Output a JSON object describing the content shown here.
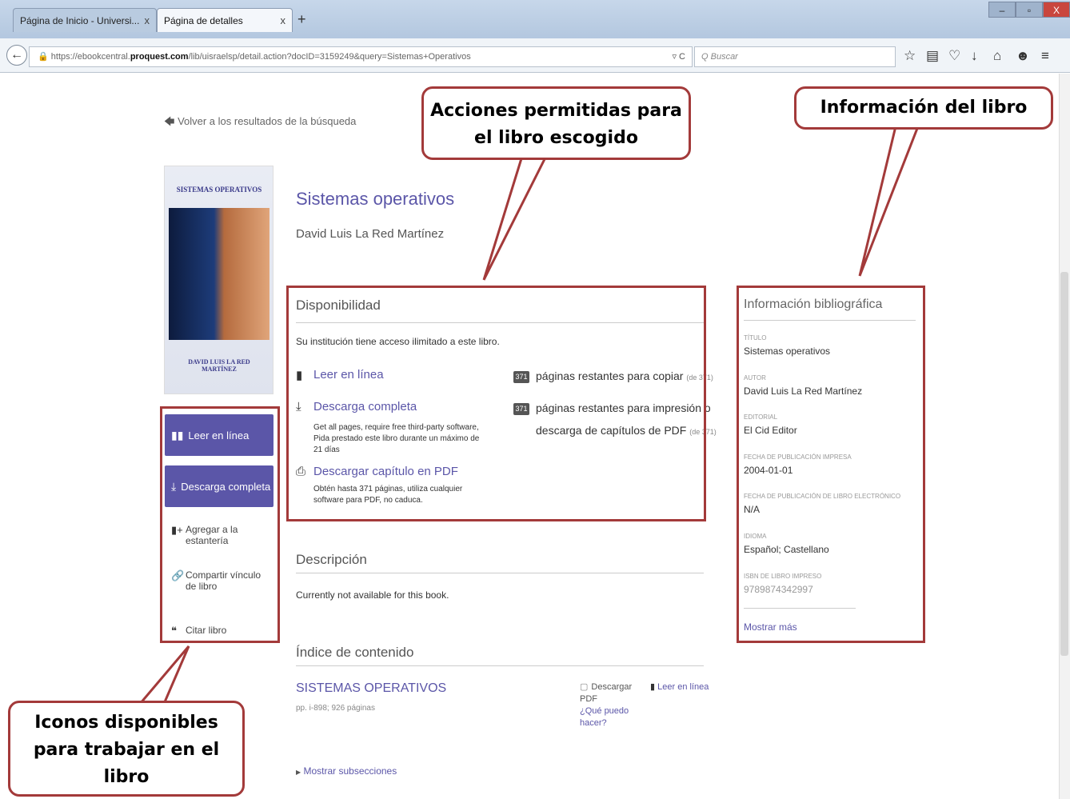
{
  "browser": {
    "tabs": [
      {
        "title": "Página de Inicio - Universi...",
        "close": "x"
      },
      {
        "title": "Página de detalles",
        "close": "x"
      }
    ],
    "new_tab": "+",
    "window_controls": [
      "–",
      "▫",
      "X"
    ],
    "back": "←",
    "url_prefix": "https://ebookcentral.",
    "url_domain": "proquest.com",
    "url_rest": "/lib/uisraelsp/detail.action?docID=3159249&query=Sistemas+Operativos",
    "reload": "▿ C",
    "search_placeholder": "Q  Buscar",
    "toolbar_icons": [
      "star-icon",
      "reading-list-icon",
      "pocket-icon",
      "download-icon",
      "home-icon",
      "chat-icon",
      "menu-icon"
    ],
    "toolbar_glyphs": [
      "☆",
      "▤",
      "♡",
      "↓",
      "⌂",
      "☻",
      "≡"
    ]
  },
  "page": {
    "back_link": "Volver a los resultados de la búsqueda",
    "cover_title": "SISTEMAS OPERATIVOS",
    "cover_author": "DAVID LUIS LA RED MARTÍNEZ",
    "book_title": "Sistemas operativos",
    "book_author": "David Luis La Red Martínez",
    "side_actions": [
      {
        "label": "Leer en línea",
        "icon": "book-icon"
      },
      {
        "label": "Descarga completa",
        "icon": "download-icon"
      }
    ],
    "side_links": [
      {
        "label": "Agregar a la estantería",
        "icon": "bookshelf-add-icon"
      },
      {
        "label": "Compartir vínculo de libro",
        "icon": "link-icon"
      },
      {
        "label": "Citar libro",
        "icon": "quote-icon"
      }
    ],
    "availability": {
      "heading": "Disponibilidad",
      "intro": "Su institución tiene acceso ilimitado a este libro.",
      "read_online": "Leer en línea",
      "full_download": "Descarga completa",
      "full_download_desc": "Get all pages, require free third-party software, Pida prestado este libro durante un máximo de 21 días",
      "pdf_chapter": "Descargar capítulo en PDF",
      "pdf_chapter_desc": "Obtén hasta 371 páginas, utiliza cualquier software para PDF, no caduca.",
      "copy_badge": "371",
      "copy_text": "páginas restantes para copiar",
      "copy_of": "(de 371)",
      "print_badge": "371",
      "print_text_1": "páginas restantes para impresión o",
      "print_text_2": "descarga de capítulos de PDF",
      "print_of": "(de 371)"
    },
    "description": {
      "heading": "Descripción",
      "text": "Currently not available for this book."
    },
    "toc": {
      "heading": "Índice de contenido",
      "chapter_title": "SISTEMAS OPERATIVOS",
      "chapter_pages": "pp. i-898; 926 páginas",
      "download_pdf": "Descargar PDF",
      "what_can_i_do": "¿Qué puedo hacer?",
      "read_online": "Leer en línea",
      "show_subsections": "Mostrar subsecciones"
    },
    "bibliographic": {
      "heading": "Información bibliográfica",
      "fields": [
        {
          "label": "Título",
          "value": "Sistemas operativos"
        },
        {
          "label": "Autor",
          "value": "David Luis La Red Martínez"
        },
        {
          "label": "Editorial",
          "value": "El Cid Editor"
        },
        {
          "label": "Fecha de publicación impresa",
          "value": "2004-01-01"
        },
        {
          "label": "Fecha de publicación de libro electrónico",
          "value": "N/A"
        },
        {
          "label": "Idioma",
          "value": "Español; Castellano"
        },
        {
          "label": "ISBN de libro impreso",
          "value": "9789874342997"
        }
      ],
      "show_more": "Mostrar más"
    }
  },
  "annotations": {
    "actions_callout": "Acciones permitidas para el libro escogido",
    "info_callout": "Información del libro",
    "icons_callout": "Iconos disponibles para trabajar en el libro",
    "color": "#a33a3a"
  },
  "colors": {
    "accent": "#5b56a8",
    "annotation": "#a33a3a"
  }
}
